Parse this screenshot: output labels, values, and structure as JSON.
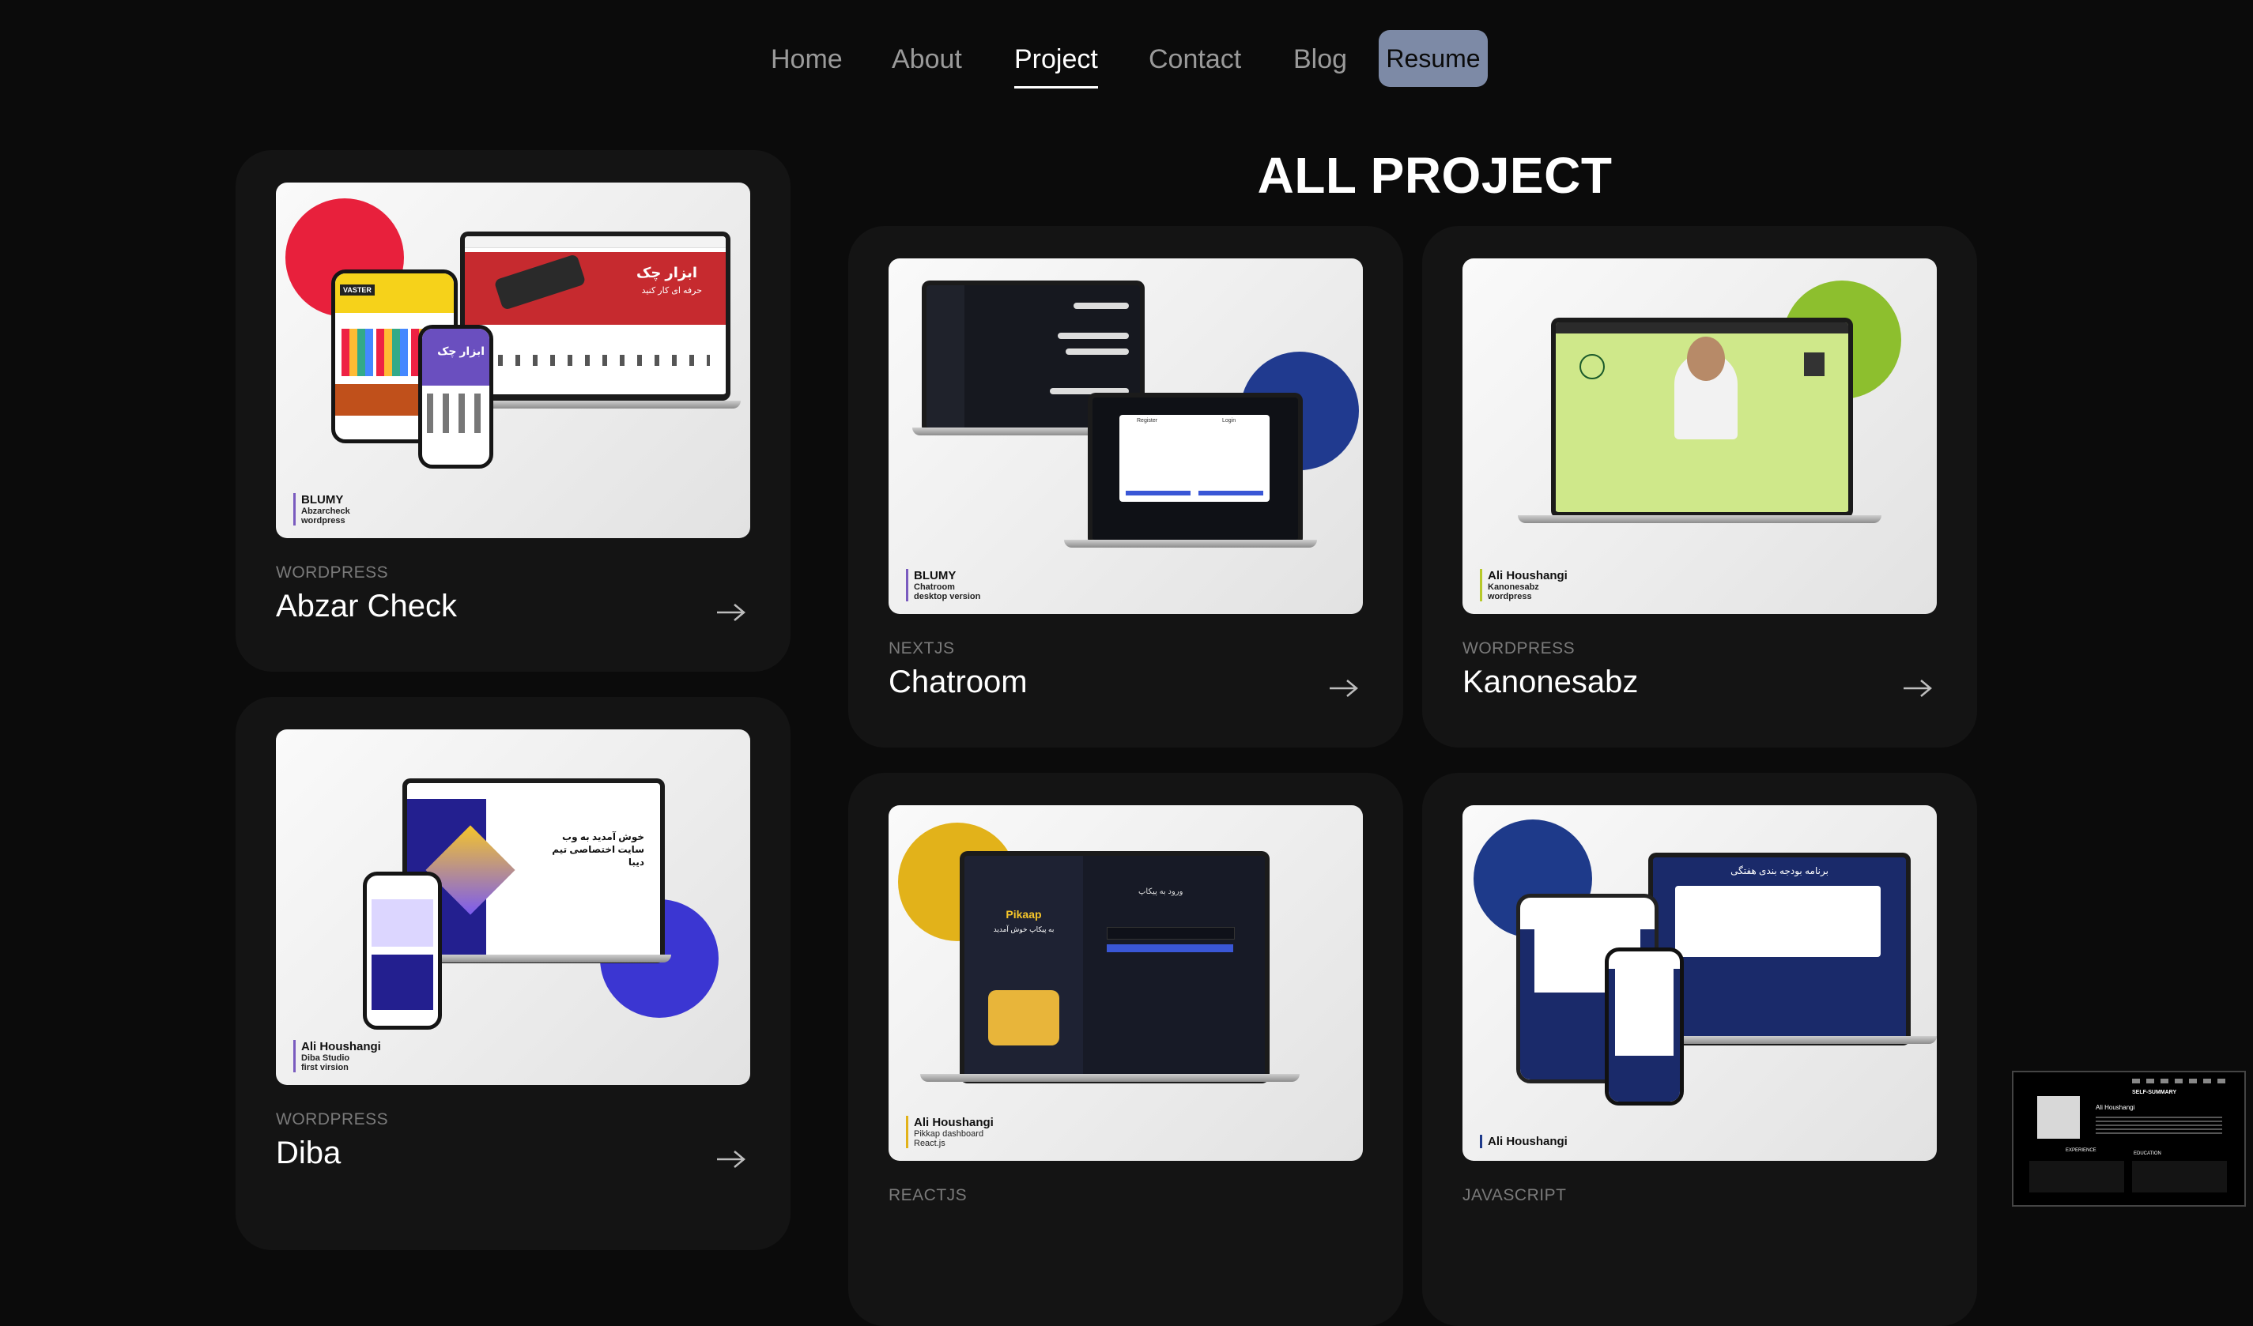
{
  "nav": {
    "items": [
      {
        "label": "Home",
        "active": false
      },
      {
        "label": "About",
        "active": false
      },
      {
        "label": "Project",
        "active": true
      },
      {
        "label": "Contact",
        "active": false
      },
      {
        "label": "Blog",
        "active": false
      }
    ],
    "resume_label": "Resume"
  },
  "page_title": "ALL PROJECT",
  "projects": [
    {
      "category": "WORDPRESS",
      "title": "Abzar Check",
      "thumb": {
        "brand": "BLUMY",
        "line1": "Abzarcheck",
        "line2": "wordpress",
        "screen_text_1": "ابزار چک",
        "screen_text_2": "حرفه ای کار کنید",
        "phone_text": "ابزار چک",
        "mobile_badge": "VASTER"
      }
    },
    {
      "category": "NEXTJS",
      "title": "Chatroom",
      "thumb": {
        "brand": "BLUMY",
        "line1": "Chatroom",
        "line2": "desktop version",
        "form_1": "Register",
        "form_2": "Login"
      }
    },
    {
      "category": "WORDPRESS",
      "title": "Kanonesabz",
      "thumb": {
        "brand": "Ali Houshangi",
        "line1": "Kanonesabz",
        "line2": "wordpress"
      }
    },
    {
      "category": "WORDPRESS",
      "title": "Diba",
      "thumb": {
        "brand": "Ali Houshangi",
        "line1": "Diba Studio",
        "line2": "first virsion",
        "screen_text": "خوش آمدید به وب سایت اختصاصی تیم دیبا"
      }
    },
    {
      "category": "REACTJS",
      "title": "",
      "thumb": {
        "brand": "Ali Houshangi",
        "line1": "Pikkap dashboard",
        "line2": "React.js",
        "app_name": "Pikaap",
        "welcome": "به پیکاپ خوش آمدید",
        "login": "ورود به پیکاپ"
      }
    },
    {
      "category": "JAVASCRIPT",
      "title": "",
      "thumb": {
        "brand": "Ali Houshangi",
        "line1": "",
        "line2": "",
        "screen_title": "برنامه بودجه بندی هفتگی"
      }
    }
  ],
  "preview": {
    "heading": "SELF-SUMMARY",
    "name": "Ali Houshangi",
    "section_1": "EXPERIENCE",
    "section_2": "EDUCATION"
  },
  "colors": {
    "background": "#0b0b0b",
    "card": "#141414",
    "resume_button": "#7d8aa6",
    "muted": "#9a9a9a"
  }
}
